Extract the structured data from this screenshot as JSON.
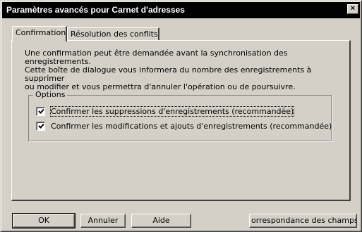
{
  "window": {
    "title": "Paramètres avancés pour Carnet d'adresses",
    "close_symbol": "×"
  },
  "tabs": [
    {
      "label": "Confirmation",
      "active": true
    },
    {
      "label": "Résolution des conflits",
      "active": false
    }
  ],
  "description": "Une confirmation peut être demandée avant la synchronisation des enregistrements.\nCette boîte de dialogue vous informera du nombre des enregistrements à supprimer\nou modifier et vous permettra d'annuler l'opération ou de poursuivre.",
  "options": {
    "group_label": "Options",
    "items": [
      {
        "label": "Confirmer les suppressions d'enregistrements (recommandée)",
        "checked": true
      },
      {
        "label": "Confirmer les modifications et ajouts d'enregistrements (recommandée)",
        "checked": true
      }
    ]
  },
  "buttons": {
    "ok": "OK",
    "cancel": "Annuler",
    "help": "Aide",
    "field_mapping": "orrespondance des champs."
  }
}
